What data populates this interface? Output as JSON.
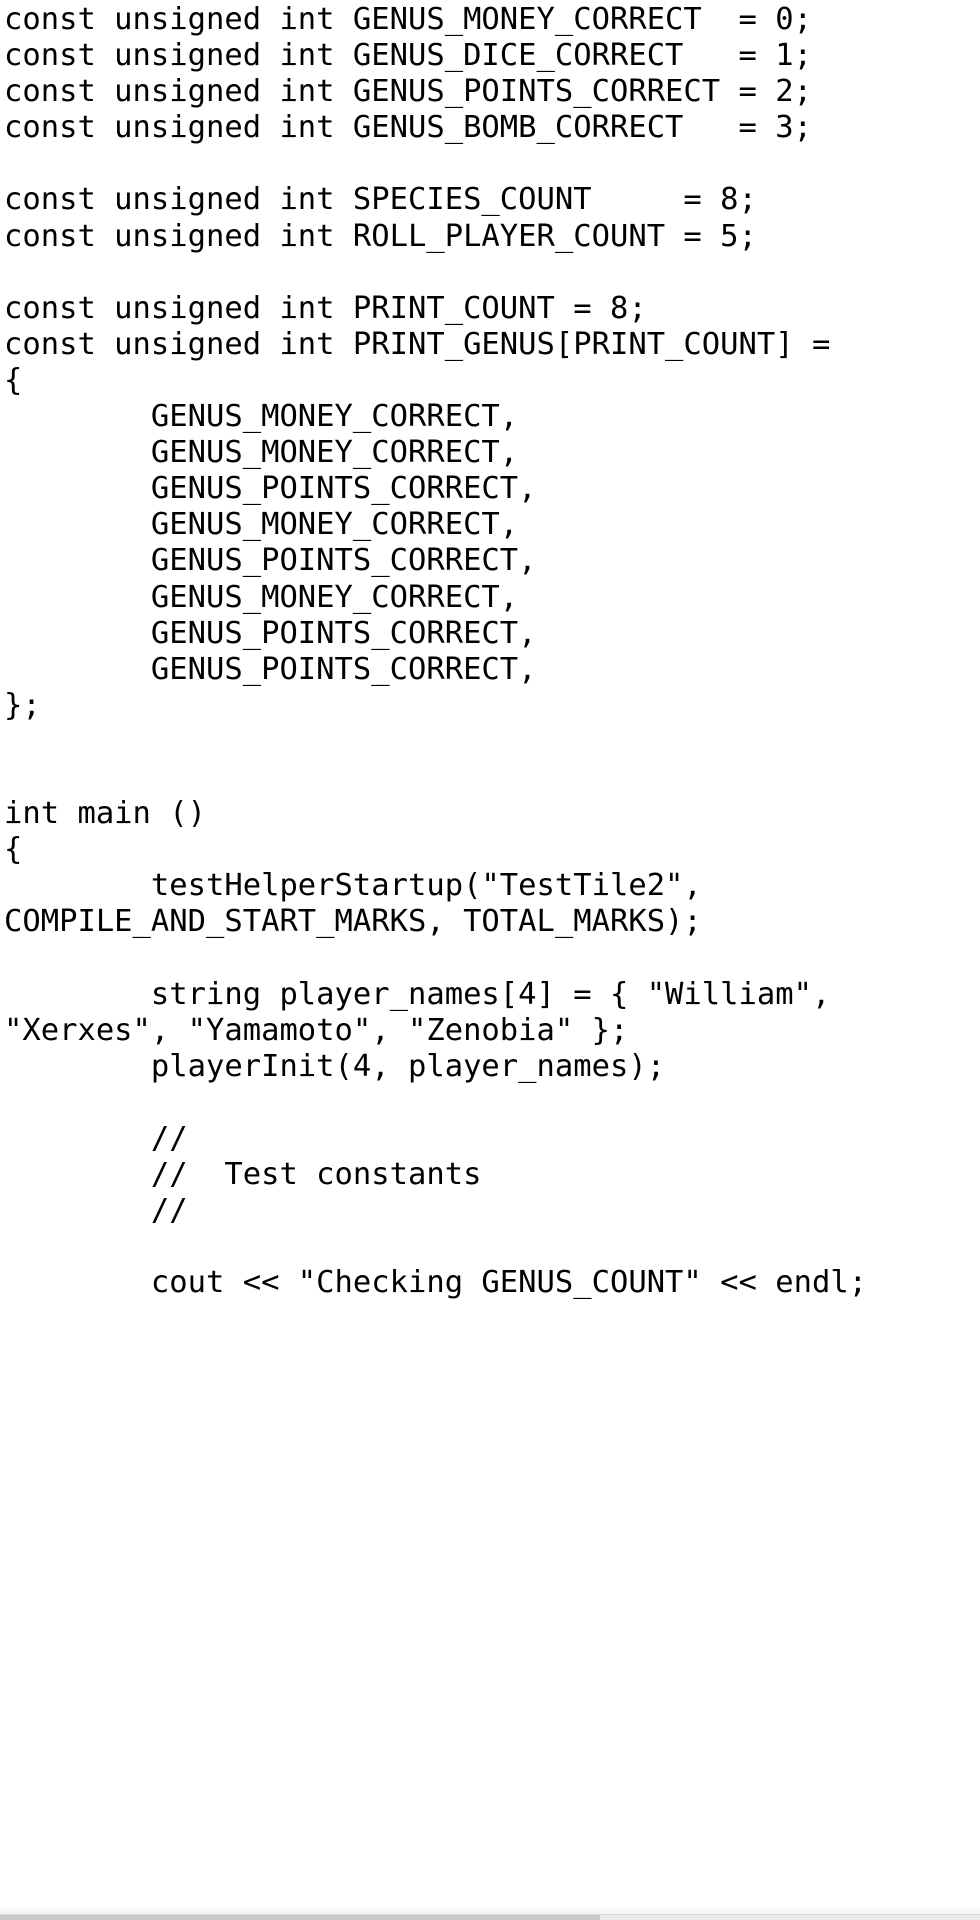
{
  "editor": {
    "language": "cpp",
    "background_color": "#ffffff",
    "text_color": "#000000",
    "wrap_enabled": true,
    "tab_width": 8
  },
  "code": {
    "full_text": "const unsigned int GENUS_MONEY_CORRECT  = 0;\nconst unsigned int GENUS_DICE_CORRECT   = 1;\nconst unsigned int GENUS_POINTS_CORRECT = 2;\nconst unsigned int GENUS_BOMB_CORRECT   = 3;\n\nconst unsigned int SPECIES_COUNT     = 8;\nconst unsigned int ROLL_PLAYER_COUNT = 5;\n\nconst unsigned int PRINT_COUNT = 8;\nconst unsigned int PRINT_GENUS[PRINT_COUNT] =\n{\n        GENUS_MONEY_CORRECT,\n        GENUS_MONEY_CORRECT,\n        GENUS_POINTS_CORRECT,\n        GENUS_MONEY_CORRECT,\n        GENUS_POINTS_CORRECT,\n        GENUS_MONEY_CORRECT,\n        GENUS_POINTS_CORRECT,\n        GENUS_POINTS_CORRECT,\n};\n\n\nint main ()\n{\n        testHelperStartup(\"TestTile2\", COMPILE_AND_START_MARKS, TOTAL_MARKS);\n\n        string player_names[4] = { \"William\", \"Xerxes\", \"Yamamoto\", \"Zenobia\" };\n        playerInit(4, player_names);\n\n        //\n        //  Test constants\n        //\n\n        cout << \"Checking GENUS_COUNT\" << endl;",
    "lines": [
      "const unsigned int GENUS_MONEY_CORRECT  = 0;",
      "const unsigned int GENUS_DICE_CORRECT   = 1;",
      "const unsigned int GENUS_POINTS_CORRECT = 2;",
      "const unsigned int GENUS_BOMB_CORRECT   = 3;",
      "",
      "const unsigned int SPECIES_COUNT     = 8;",
      "const unsigned int ROLL_PLAYER_COUNT = 5;",
      "",
      "const unsigned int PRINT_COUNT = 8;",
      "const unsigned int PRINT_GENUS[PRINT_COUNT] =",
      "{",
      "        GENUS_MONEY_CORRECT,",
      "        GENUS_MONEY_CORRECT,",
      "        GENUS_POINTS_CORRECT,",
      "        GENUS_MONEY_CORRECT,",
      "        GENUS_POINTS_CORRECT,",
      "        GENUS_MONEY_CORRECT,",
      "        GENUS_POINTS_CORRECT,",
      "        GENUS_POINTS_CORRECT,",
      "};",
      "",
      "",
      "int main ()",
      "{",
      "        testHelperStartup(\"TestTile2\", COMPILE_AND_START_MARKS, TOTAL_MARKS);",
      "",
      "        string player_names[4] = { \"William\", \"Xerxes\", \"Yamamoto\", \"Zenobia\" };",
      "        playerInit(4, player_names);",
      "",
      "        //",
      "        //  Test constants",
      "        //",
      "",
      "        cout << \"Checking GENUS_COUNT\" << endl;"
    ],
    "constants": [
      {
        "name": "GENUS_MONEY_CORRECT",
        "type": "const unsigned int",
        "value": "0"
      },
      {
        "name": "GENUS_DICE_CORRECT",
        "type": "const unsigned int",
        "value": "1"
      },
      {
        "name": "GENUS_POINTS_CORRECT",
        "type": "const unsigned int",
        "value": "2"
      },
      {
        "name": "GENUS_BOMB_CORRECT",
        "type": "const unsigned int",
        "value": "3"
      },
      {
        "name": "SPECIES_COUNT",
        "type": "const unsigned int",
        "value": "8"
      },
      {
        "name": "ROLL_PLAYER_COUNT",
        "type": "const unsigned int",
        "value": "5"
      },
      {
        "name": "PRINT_COUNT",
        "type": "const unsigned int",
        "value": "8"
      }
    ],
    "print_genus_array": [
      "GENUS_MONEY_CORRECT",
      "GENUS_MONEY_CORRECT",
      "GENUS_POINTS_CORRECT",
      "GENUS_MONEY_CORRECT",
      "GENUS_POINTS_CORRECT",
      "GENUS_MONEY_CORRECT",
      "GENUS_POINTS_CORRECT",
      "GENUS_POINTS_CORRECT"
    ],
    "player_names": [
      "William",
      "Xerxes",
      "Yamamoto",
      "Zenobia"
    ],
    "test_name": "TestTile2",
    "comment_block": [
      "//",
      "//  Test constants",
      "//"
    ],
    "output_string": "Checking GENUS_COUNT"
  }
}
